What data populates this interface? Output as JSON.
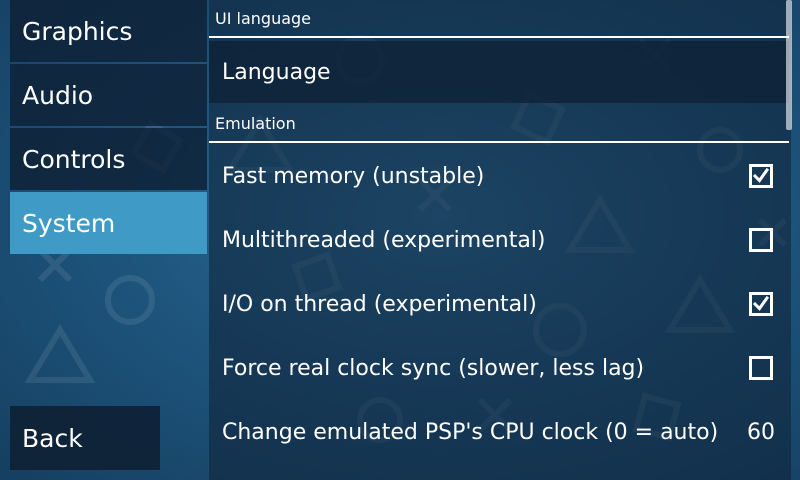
{
  "sidebar": {
    "items": [
      {
        "label": "Graphics"
      },
      {
        "label": "Audio"
      },
      {
        "label": "Controls"
      },
      {
        "label": "System",
        "selected": true
      }
    ],
    "back_label": "Back"
  },
  "settings": {
    "ui_language": {
      "header": "UI language",
      "language_label": "Language"
    },
    "emulation": {
      "header": "Emulation",
      "fast_memory": {
        "label": "Fast memory (unstable)",
        "checked": true
      },
      "multithreaded": {
        "label": "Multithreaded (experimental)",
        "checked": false
      },
      "io_on_thread": {
        "label": "I/O on thread (experimental)",
        "checked": true
      },
      "force_real_clock_sync": {
        "label": "Force real clock sync (slower, less lag)",
        "checked": false
      },
      "cpu_clock": {
        "label": "Change emulated PSP's CPU clock (0 = auto)",
        "value": "60"
      }
    }
  },
  "colors": {
    "accent_selected": "#3f9ac5",
    "background": "#1f5780"
  },
  "icons": {
    "checked": "checkmark-icon",
    "unchecked": "empty-checkbox-icon"
  }
}
